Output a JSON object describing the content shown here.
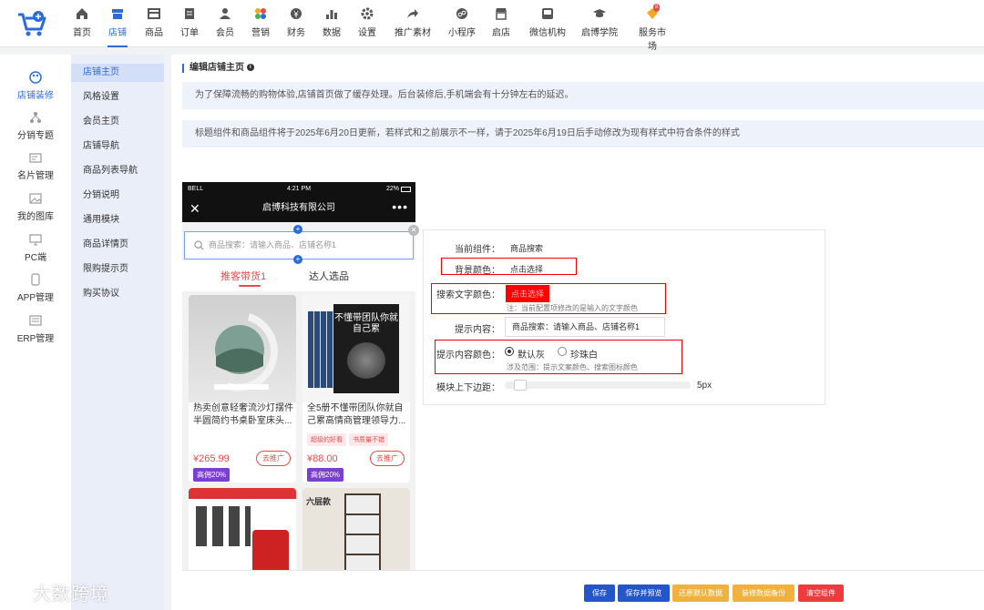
{
  "nav": [
    {
      "label": "首页",
      "icon": "home-icon"
    },
    {
      "label": "店铺",
      "icon": "store-icon",
      "active": true
    },
    {
      "label": "商品",
      "icon": "goods-icon"
    },
    {
      "label": "订单",
      "icon": "order-icon"
    },
    {
      "label": "会员",
      "icon": "member-icon"
    },
    {
      "label": "营销",
      "icon": "marketing-icon"
    },
    {
      "label": "财务",
      "icon": "finance-icon"
    },
    {
      "label": "数据",
      "icon": "data-icon"
    },
    {
      "label": "设置",
      "icon": "gear-icon"
    },
    {
      "label": "推广素材",
      "icon": "share-icon"
    },
    {
      "label": "小程序",
      "icon": "miniapp-icon"
    },
    {
      "label": "启店",
      "icon": "shop-icon"
    },
    {
      "label": "微信机构",
      "icon": "wechat-icon"
    },
    {
      "label": "启博学院",
      "icon": "academy-icon"
    },
    {
      "label": "服务市场",
      "icon": "service-icon",
      "badge": "8"
    }
  ],
  "sidebar": [
    {
      "label": "店铺装修",
      "icon": "palette-icon",
      "active": true
    },
    {
      "label": "分销专题",
      "icon": "network-icon"
    },
    {
      "label": "名片管理",
      "icon": "card-icon"
    },
    {
      "label": "我的图库",
      "icon": "image-icon"
    },
    {
      "label": "PC端",
      "icon": "monitor-icon"
    },
    {
      "label": "APP管理",
      "icon": "phone-icon"
    },
    {
      "label": "ERP管理",
      "icon": "erp-icon"
    }
  ],
  "subnav": [
    "店铺主页",
    "风格设置",
    "会员主页",
    "店铺导航",
    "商品列表导航",
    "分销说明",
    "通用模块",
    "商品详情页",
    "限购提示页",
    "购买协议"
  ],
  "main": {
    "title": "编辑店铺主页",
    "notice1": "为了保障流畅的购物体验,店铺首页做了缓存处理。后台装修后,手机端会有十分钟左右的延迟。",
    "notice2": "标题组件和商品组件将于2025年6月20日更新，若样式和之前展示不一样，请于2025年6月19日后手动修改为现有样式中符合条件的样式"
  },
  "phone": {
    "carrier": "BELL",
    "time": "4:21 PM",
    "battery": "22%",
    "title": "启博科技有限公司",
    "search_placeholder": "商品搜索：请输入商品、店铺名称1",
    "tabs": [
      "推客带货1",
      "达人选品"
    ],
    "products": [
      {
        "name": "热卖创意轻奢流沙灯摆件半圆简约书桌卧室床头...",
        "price": "¥265.99",
        "commission": "高佣20%",
        "tags": [],
        "promo": "去推广"
      },
      {
        "name": "全5册不懂带团队你就自己累高情商管理领导力...",
        "price": "¥88.00",
        "commission": "高佣20%",
        "tags": [
          "超级的好看",
          "书质量不错"
        ],
        "promo": "去推广",
        "cover_text": "不懂带团队你就自己累"
      },
      {
        "name": "",
        "price": "",
        "commission": "",
        "tags": [],
        "promo": ""
      },
      {
        "name": "",
        "price": "",
        "commission": "",
        "tags": [],
        "promo": "",
        "cover_text": "六层款"
      }
    ]
  },
  "editor": {
    "current_label": "当前组件：",
    "current_value": "商品搜索",
    "bg_label": "背景颜色：",
    "bg_value": "点击选择",
    "text_color_label": "搜索文字颜色：",
    "text_color_value": "点击选择",
    "text_color_note": "注：当前配置项修改的是输入的文字颜色",
    "hint_label": "提示内容：",
    "hint_value": "商品搜索：请输入商品、店铺名称1",
    "hint_color_label": "提示内容颜色：",
    "option1": "默认灰",
    "option2": "珍珠白",
    "hint_color_note": "涉及范围：提示文案颜色、搜索图标颜色",
    "margin_label": "模块上下边距：",
    "margin_value": "5px",
    "margin_level": 0.03
  },
  "buttons": [
    {
      "label": "保存",
      "color": "#2456c9"
    },
    {
      "label": "保存并预览",
      "color": "#2456c9"
    },
    {
      "label": "还原默认数据",
      "color": "#f0b23c"
    },
    {
      "label": "装修数据备份",
      "color": "#f0b23c"
    },
    {
      "label": "清空组件",
      "color": "#ee3b3b"
    }
  ],
  "watermark": "大数跨境",
  "colors": {
    "accent": "#2d6bd8",
    "danger": "#ee3b3b",
    "highlight": "#ff0000",
    "commission": "#7a3ed1"
  }
}
